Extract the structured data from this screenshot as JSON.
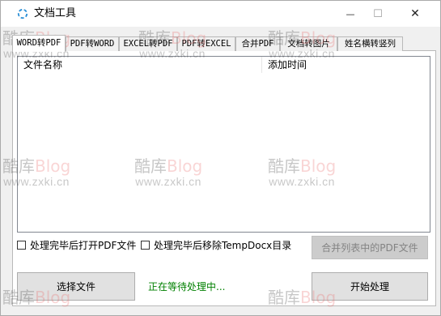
{
  "window": {
    "title": "文档工具",
    "minimize_glyph": "—",
    "maximize_glyph": "☐",
    "close_glyph": "✕"
  },
  "tabs": [
    {
      "label": "WORD转PDF",
      "active": true
    },
    {
      "label": "PDF转WORD",
      "active": false
    },
    {
      "label": "EXCEL转PDF",
      "active": false
    },
    {
      "label": "PDF转EXCEL",
      "active": false
    },
    {
      "label": "合并PDF",
      "active": false
    },
    {
      "label": "文档转图片",
      "active": false
    },
    {
      "label": "姓名横转竖列",
      "active": false
    }
  ],
  "list": {
    "columns": [
      "文件名称",
      "添加时间"
    ],
    "rows": []
  },
  "options": {
    "open_after": {
      "label": "处理完毕后打开PDF文件",
      "checked": false
    },
    "remove_temp": {
      "label": "处理完毕后移除TempDocx目录",
      "checked": false
    }
  },
  "buttons": {
    "merge": "合并列表中的PDF文件",
    "choose": "选择文件",
    "start": "开始处理"
  },
  "status": "正在等待处理中...",
  "watermark": {
    "brand": "酷库",
    "blog": "Blog",
    "url": "www.zxki.cn"
  },
  "colors": {
    "status": "#008000",
    "watermark_accent": "#ea6b6b"
  }
}
